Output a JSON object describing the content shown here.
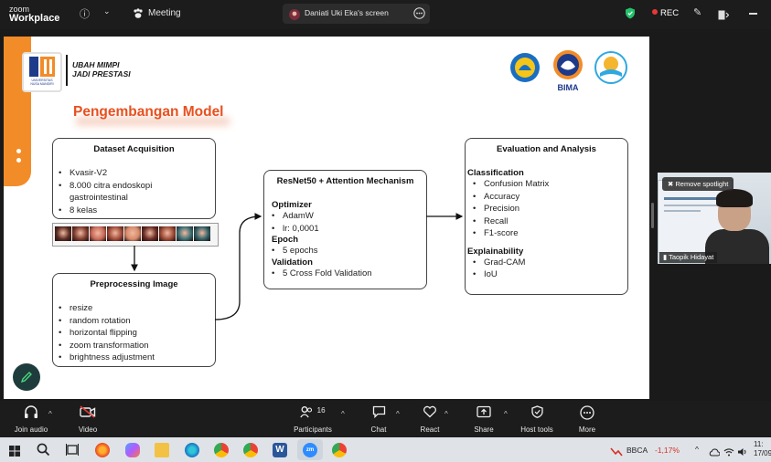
{
  "zoom_topbar": {
    "logo_line1": "zoom",
    "logo_line2": "Workplace",
    "meeting_label": "Meeting",
    "share_banner": "Daniati Uki Eka's screen",
    "rec_label": "REC"
  },
  "slide": {
    "motto_line1": "UBAH MIMPI",
    "motto_line2": "JADI PRESTASI",
    "logo_text_univ": "UNIVERSITAS",
    "logo_text_name": "NUSA MANDIRI",
    "partner_logo_text": "BIMA",
    "title": "Pengembangan Model",
    "dataset": {
      "heading": "Dataset Acquisition",
      "items": [
        "Kvasir-V2",
        "8.000 citra endoskopi gastrointestinal",
        "8 kelas"
      ]
    },
    "preprocessing": {
      "heading": "Preprocessing Image",
      "items": [
        "resize",
        "random rotation",
        "horizontal flipping",
        "zoom transformation",
        "brightness adjustment"
      ]
    },
    "model": {
      "heading": "ResNet50 + Attention Mechanism",
      "sections": [
        {
          "title": "Optimizer",
          "items": [
            "AdamW",
            "lr: 0,0001"
          ]
        },
        {
          "title": "Epoch",
          "items": [
            "5 epochs"
          ]
        },
        {
          "title": "Validation",
          "items": [
            "5 Cross Fold Validation"
          ]
        }
      ]
    },
    "evaluation": {
      "heading": "Evaluation and Analysis",
      "sections": [
        {
          "title": "Classification",
          "items": [
            "Confusion Matrix",
            "Accuracy",
            "Precision",
            "Recall",
            "F1-score"
          ]
        },
        {
          "title": "Explainability",
          "items": [
            "Grad-CAM",
            "IoU"
          ]
        }
      ]
    },
    "thumbnail_colors": [
      "#5a2b22",
      "#7d3b2e",
      "#c96a5a",
      "#a24b3a",
      "#d88a6a",
      "#6a2c26",
      "#9c4a36",
      "#3c6e74",
      "#2f5f66"
    ]
  },
  "spotlight": {
    "remove_label": "Remove spotlight",
    "participant_name": "Taopik Hidayat"
  },
  "toolbar": {
    "join_audio": "Join audio",
    "video": "Video",
    "participants": "Participants",
    "participants_count": "16",
    "chat": "Chat",
    "react": "React",
    "share": "Share",
    "host_tools": "Host tools",
    "more": "More"
  },
  "taskbar": {
    "stock_ticker": "BBCA",
    "stock_change": "-1,17%",
    "clock_time": "11:",
    "clock_date": "17/09"
  }
}
